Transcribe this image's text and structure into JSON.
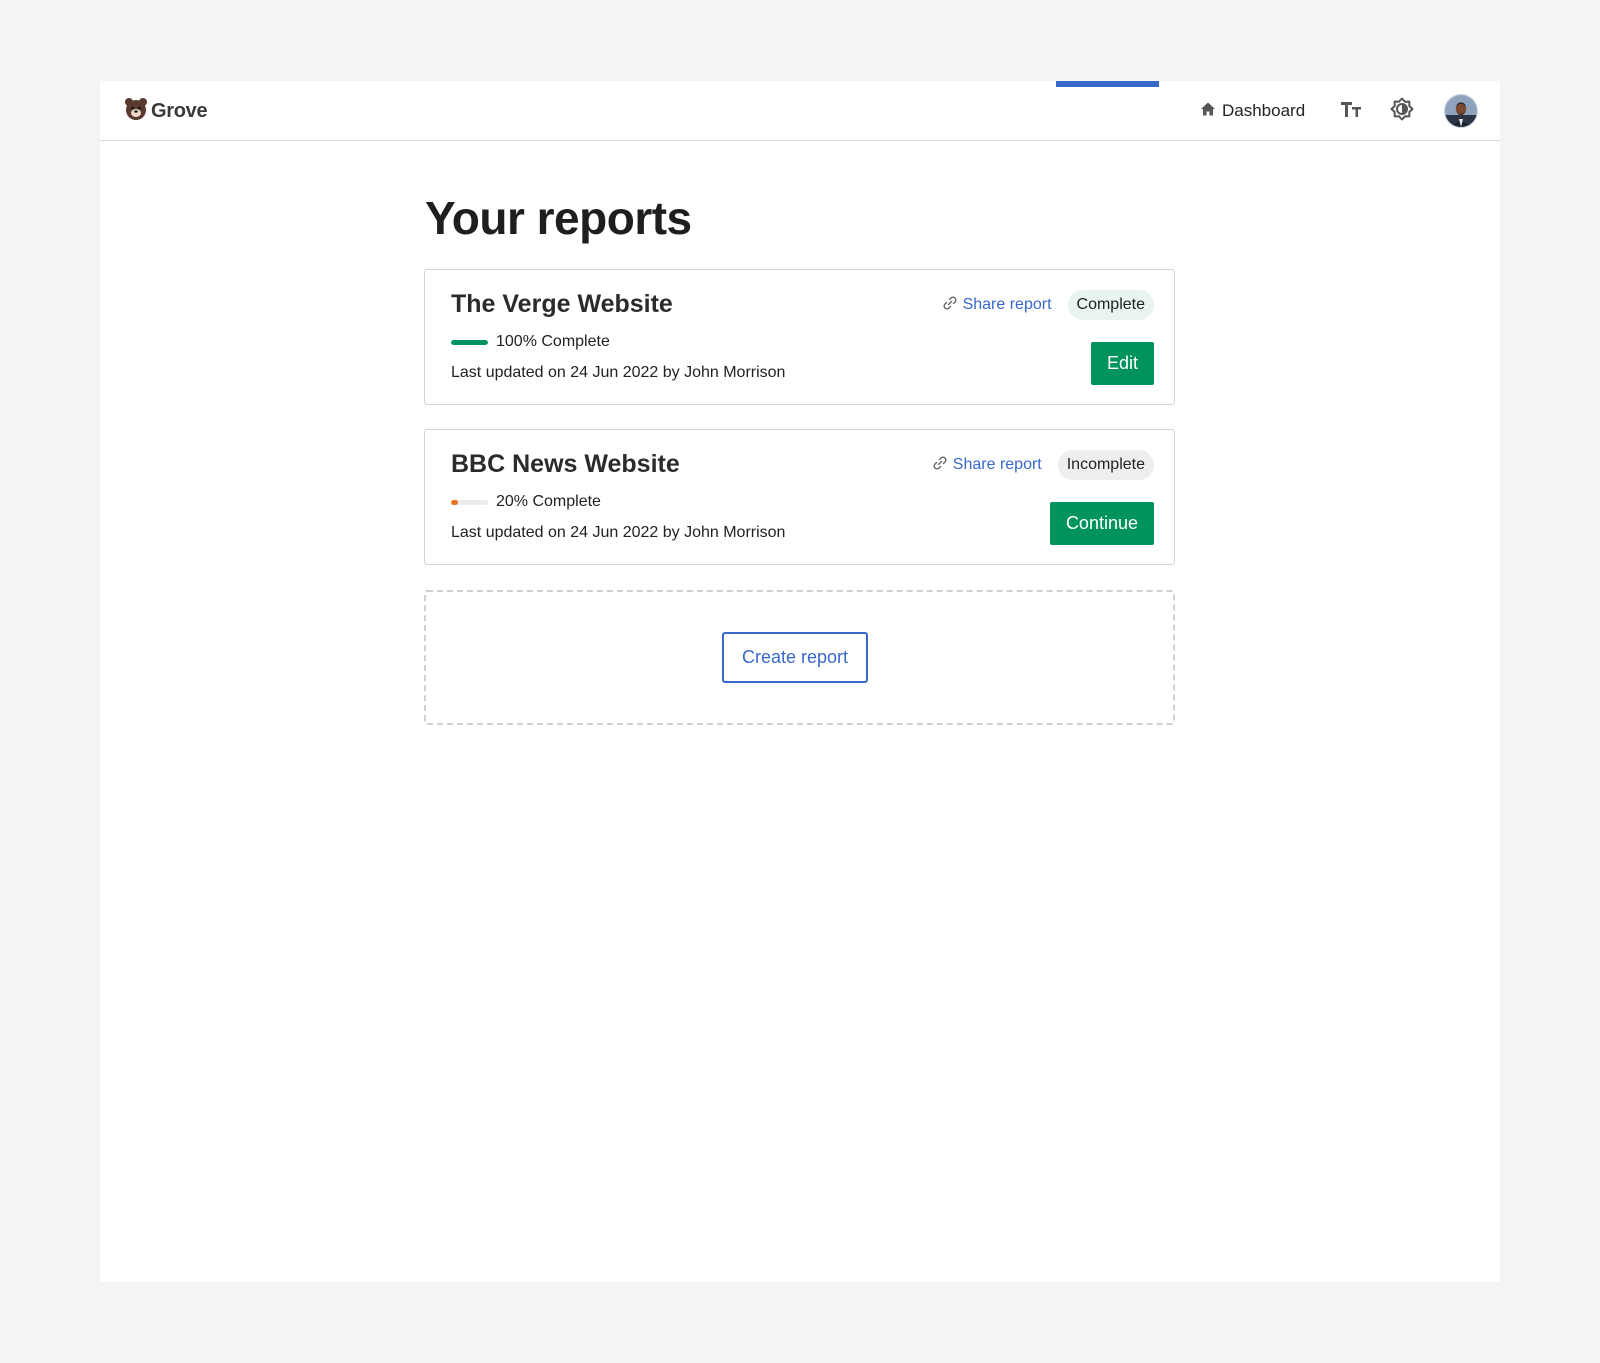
{
  "app": {
    "logo_text": "Grove",
    "logo_icon": "bear-icon"
  },
  "nav": {
    "dashboard_label": "Dashboard",
    "text_size_icon": "text-size-icon",
    "theme_icon": "brightness-icon",
    "avatar_icon": "user-avatar"
  },
  "page": {
    "title": "Your reports"
  },
  "reports": [
    {
      "title": "The Verge Website",
      "progress_percent": 100,
      "progress_label": "100% Complete",
      "progress_color": "#00935e",
      "updated": "Last updated on 24 Jun 2022 by John Morrison",
      "share_label": "Share report",
      "status": "Complete",
      "action_label": "Edit"
    },
    {
      "title": "BBC News Website",
      "progress_percent": 20,
      "progress_label": "20% Complete",
      "progress_color": "#e8731c",
      "updated": "Last updated on 24 Jun 2022 by John Morrison",
      "share_label": "Share report",
      "status": "Incomplete",
      "action_label": "Continue"
    }
  ],
  "create": {
    "label": "Create report"
  },
  "colors": {
    "accent": "#3868c8",
    "primary": "#00935e",
    "warning": "#e8731c"
  }
}
